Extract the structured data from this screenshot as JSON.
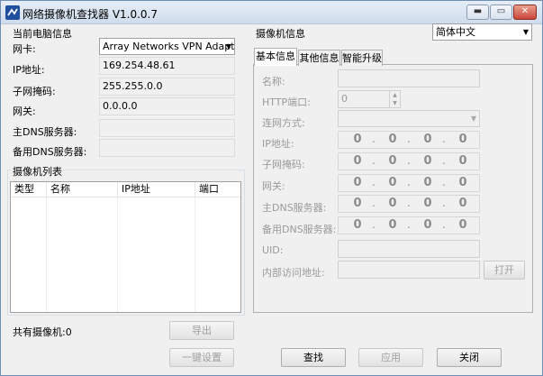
{
  "window": {
    "title": "网络摄像机查找器 V1.0.0.7",
    "controls": {
      "minimize": "▬",
      "restore": "▭",
      "close": "✕"
    }
  },
  "pc_info": {
    "group_title": "当前电脑信息",
    "nic_label": "网卡:",
    "nic_value": "Array Networks VPN Adapter",
    "ip_label": "IP地址:",
    "ip_value": "169.254.48.61",
    "mask_label": "子网掩码:",
    "mask_value": "255.255.0.0",
    "gateway_label": "网关:",
    "gateway_value": "0.0.0.0",
    "dns1_label": "主DNS服务器:",
    "dns1_value": "",
    "dns2_label": "备用DNS服务器:",
    "dns2_value": ""
  },
  "camera_list": {
    "group_title": "摄像机列表",
    "columns": [
      "类型",
      "名称",
      "IP地址",
      "端口"
    ],
    "count_text": "共有摄像机:0",
    "export_label": "导出"
  },
  "camera_info": {
    "title": "摄像机信息",
    "language": "简体中文",
    "tabs": [
      "基本信息",
      "其他信息",
      "智能升级"
    ],
    "name_label": "名称:",
    "name_value": "",
    "http_port_label": "HTTP端口:",
    "http_port_value": "0",
    "conn_label": "连网方式:",
    "conn_value": "",
    "ip_label": "IP地址:",
    "mask_label": "子网掩码:",
    "gateway_label": "网关:",
    "dns1_label": "主DNS服务器:",
    "dns2_label": "备用DNS服务器:",
    "octet": "0",
    "dot": ".",
    "uid_label": "UID:",
    "uid_value": "",
    "internal_label": "内部访问地址:",
    "internal_value": "",
    "open_label": "打开"
  },
  "bottom": {
    "onekey_label": "一键设置",
    "search_label": "查找",
    "apply_label": "应用",
    "close_label": "关闭"
  }
}
